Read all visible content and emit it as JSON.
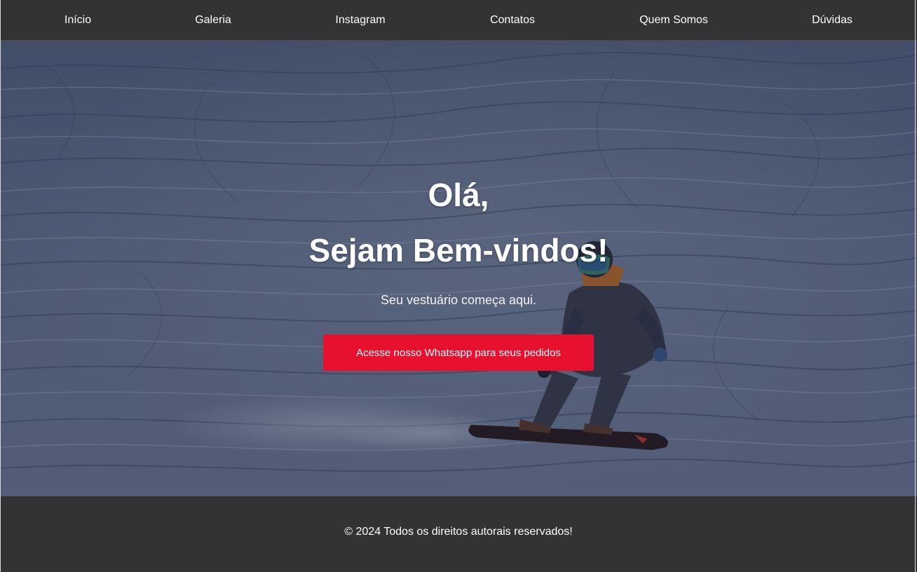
{
  "nav": {
    "items": [
      {
        "label": "Início"
      },
      {
        "label": "Galeria"
      },
      {
        "label": "Instagram"
      },
      {
        "label": "Contatos"
      },
      {
        "label": "Quem Somos"
      },
      {
        "label": "Dúvidas"
      }
    ]
  },
  "hero": {
    "greeting": "Olá,",
    "welcome": "Sejam Bem-vindos!",
    "tagline": "Seu vestuário começa aqui.",
    "cta_label": "Acesse nosso Whatsapp para seus pedidos"
  },
  "footer": {
    "copyright": "© 2024 Todos os direitos autorais reservados!"
  },
  "colors": {
    "nav_background": "#333333",
    "cta_background": "#e8102f",
    "footer_background": "#333333",
    "text": "#ffffff"
  }
}
